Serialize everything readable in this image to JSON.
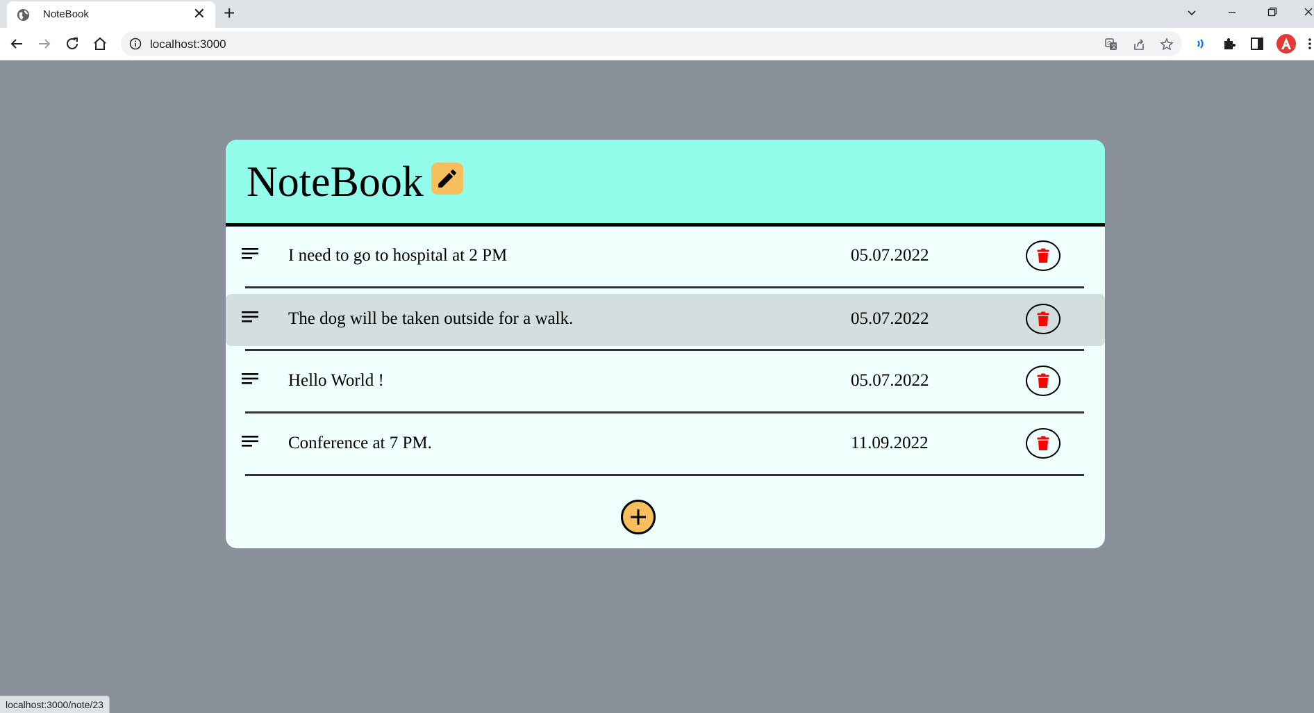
{
  "browser": {
    "tab_title": "NoteBook",
    "new_tab_label": "+",
    "close_tab_label": "✕",
    "url": "localhost:3000",
    "status_url": "localhost:3000/note/23"
  },
  "app": {
    "title": "NoteBook",
    "notes": [
      {
        "text": "I need to go to hospital at 2 PM",
        "date": "05.07.2022"
      },
      {
        "text": "The dog will be taken outside for a walk.",
        "date": "05.07.2022"
      },
      {
        "text": "Hello World !",
        "date": "05.07.2022"
      },
      {
        "text": "Conference at 7 PM.",
        "date": "11.09.2022"
      }
    ],
    "colors": {
      "header_bg": "#93fdec",
      "card_bg": "#effffc",
      "accent": "#f6be5c",
      "delete": "#ff0000",
      "highlight_row": "#d3dfdf",
      "page_bg": "#8a9099"
    }
  }
}
